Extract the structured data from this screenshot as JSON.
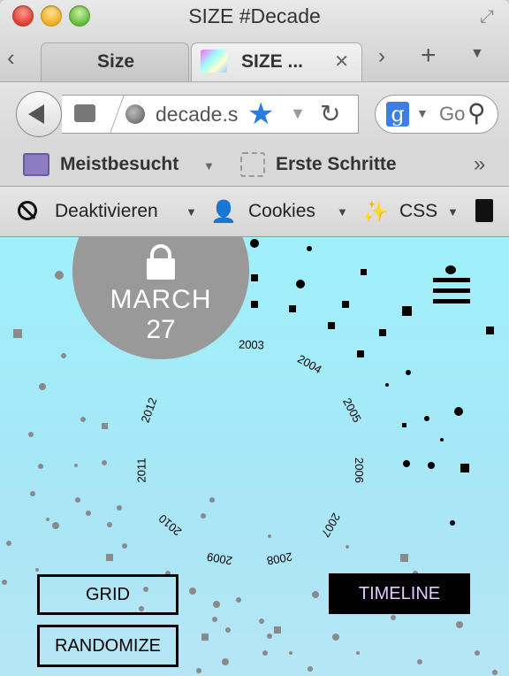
{
  "window": {
    "title": "SIZE #Decade"
  },
  "tabs": [
    {
      "label": "Size",
      "active": false
    },
    {
      "label": "SIZE ...",
      "active": true
    }
  ],
  "navbar": {
    "url": "decade.s",
    "search_placeholder": "Go"
  },
  "bookmarks": [
    {
      "label": "Meistbesucht"
    },
    {
      "label": "Erste Schritte"
    }
  ],
  "devtools": [
    {
      "label": "Deaktivieren"
    },
    {
      "label": "Cookies"
    },
    {
      "label": "CSS"
    }
  ],
  "page": {
    "date": {
      "month": "MARCH",
      "day": "27"
    },
    "years": [
      "2003",
      "2004",
      "2005",
      "2006",
      "2007",
      "2008",
      "2009",
      "2010",
      "2011",
      "2012"
    ],
    "buttons": {
      "grid": "GRID",
      "randomize": "RANDOMIZE",
      "timeline": "TIMELINE"
    },
    "colors": {
      "background_top": "#9ff0fb",
      "background_bottom": "#b6e6f6",
      "circle": "#999999",
      "timeline_text": "#e6c8ff"
    }
  }
}
